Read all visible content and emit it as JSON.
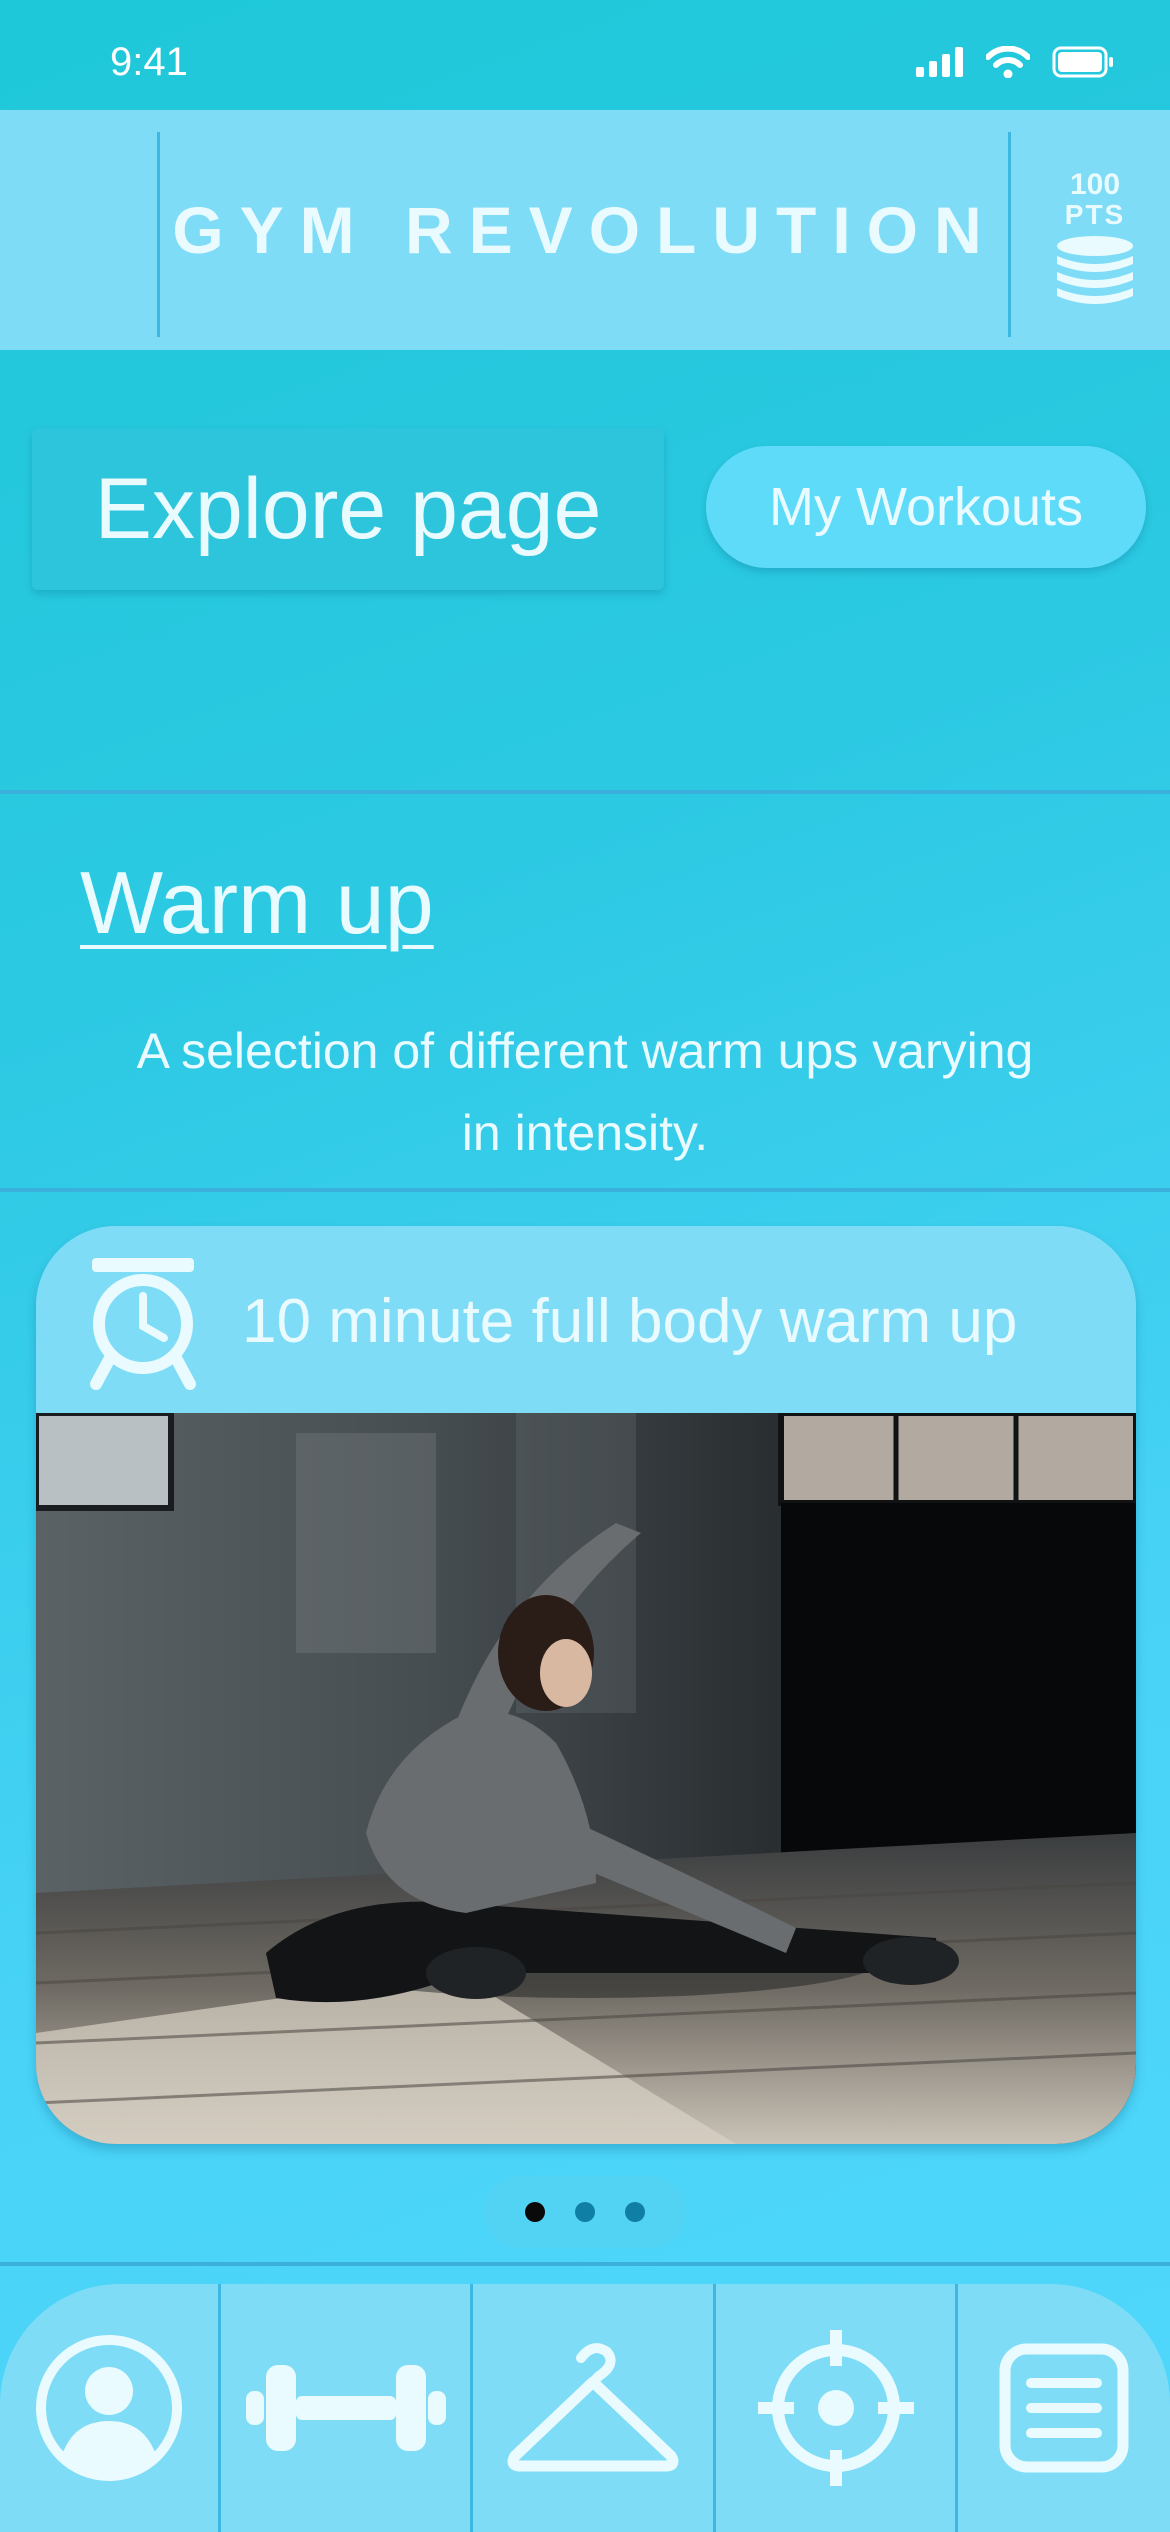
{
  "status_bar": {
    "time": "9:41"
  },
  "header": {
    "title": "GYM REVOLUTION",
    "points_value": "100",
    "points_unit": "PTS"
  },
  "tabs": {
    "active": "Explore page",
    "inactive": "My Workouts"
  },
  "section": {
    "title": "Warm up",
    "description": "A selection of different warm ups varying in intensity."
  },
  "card": {
    "title": "10 minute full body warm up"
  },
  "pager": {
    "count": 3,
    "active_index": 0
  },
  "bottom_nav": {
    "items": [
      "profile-icon",
      "dumbbell-icon",
      "hanger-icon",
      "target-icon",
      "notes-icon"
    ]
  },
  "colors": {
    "background": "#2cc9e3",
    "panel": "#7edcf7",
    "text": "#e9fbff",
    "divider": "#3fb7e3"
  }
}
